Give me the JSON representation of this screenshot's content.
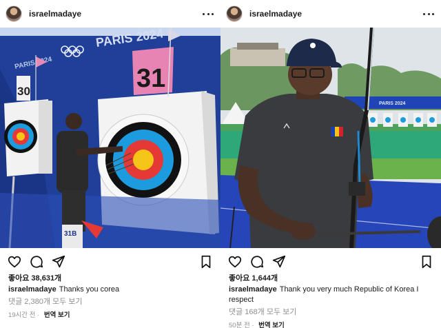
{
  "posts": [
    {
      "username": "israelmadaye",
      "likes": "좋아요 38,631개",
      "caption_user": "israelmadaye",
      "caption_text": "Thanks you corea",
      "comments": "댓글 2,380개 모두 보기",
      "time": "19시간 전",
      "translate": "번역 보기",
      "photo": {
        "brand_text_1": "PARIS 2024",
        "brand_text_2": "PARIS 2024",
        "target_number_1": "30",
        "target_number_2": "31",
        "bib": "31B"
      }
    },
    {
      "username": "israelmadaye",
      "likes": "좋아요 1,644개",
      "caption_user": "israelmadaye",
      "caption_text": "Thank you very much Republic of Korea I respect",
      "comments": "댓글 168개 모두 보기",
      "time": "50분 전",
      "translate": "번역 보기",
      "photo": {
        "banner_text": "PARIS 2024"
      }
    }
  ],
  "icons": {
    "like": "heart-icon",
    "comment": "comment-icon",
    "share": "share-icon",
    "save": "bookmark-icon",
    "more": "more-icon"
  },
  "colors": {
    "text": "#1b1b1b",
    "muted": "#8e8e8e"
  }
}
